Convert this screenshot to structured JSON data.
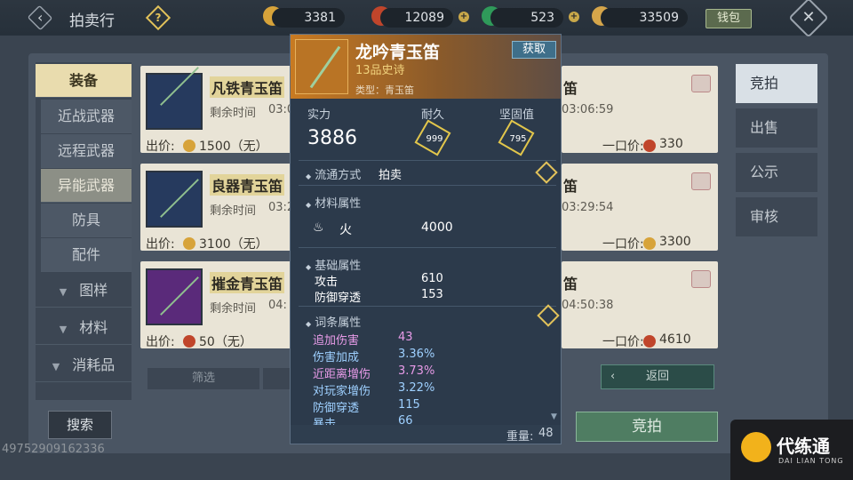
{
  "header": {
    "title": "拍卖行",
    "help": "?",
    "currencies": [
      {
        "icon": "gold-ingot-icon",
        "value": "3381",
        "color": "#d7a33a"
      },
      {
        "icon": "red-coin-icon",
        "value": "12089",
        "color": "#c0452b"
      },
      {
        "icon": "jade-icon",
        "value": "523",
        "color": "#2f9a5a"
      },
      {
        "icon": "feather-coin-icon",
        "value": "33509",
        "color": "#d5a54a"
      }
    ],
    "bag_label": "钱包"
  },
  "left_nav": [
    {
      "label": "装备",
      "state": "active"
    },
    {
      "label": "近战武器"
    },
    {
      "label": "远程武器"
    },
    {
      "label": "异能武器",
      "state": "sub"
    },
    {
      "label": "防具"
    },
    {
      "label": "配件"
    },
    {
      "label": "图样"
    },
    {
      "label": "材料"
    },
    {
      "label": "消耗品"
    }
  ],
  "listings": [
    {
      "name": "凡铁青玉笛",
      "remain_label": "剩余时间",
      "remain": "03:0",
      "price_label": "出价:",
      "price": "1500（无）",
      "thumb_color": "#263a5e"
    },
    {
      "name": "良器青玉笛",
      "remain_label": "剩余时间",
      "remain": "03:2",
      "price_label": "出价:",
      "price": "3100（无）",
      "thumb_color": "#263a5e"
    },
    {
      "name": "摧金青玉笛",
      "remain_label": "剩余时间",
      "remain": "04:",
      "price_label": "出价:",
      "price": "50（无）",
      "thumb_color": "#5a2a7a"
    }
  ],
  "listings_right": [
    {
      "name": "笛",
      "remain": "03:06:59",
      "buyout_label": "一口价:",
      "buyout": "330"
    },
    {
      "name": "笛",
      "remain": "03:29:54",
      "buyout_label": "一口价:",
      "buyout": "3300"
    },
    {
      "name": "笛",
      "remain": "04:50:38",
      "buyout_label": "一口价:",
      "buyout": "4610"
    }
  ],
  "right_nav": [
    "竞拍",
    "出售",
    "公示",
    "审核"
  ],
  "filter_label": "筛选",
  "return_label": "返回",
  "search_label": "搜索",
  "bid_label": "竞拍",
  "player_id": "49752909162336",
  "brand": {
    "name": "代练通",
    "sub": "DAI LIAN TONG"
  },
  "popup": {
    "name": "龙吟青玉笛",
    "rarity": "13品史诗",
    "type": "类型：青玉笛",
    "get_label": "获取",
    "stats": {
      "power_label": "实力",
      "power": "3886",
      "durability_label": "耐久",
      "durability": "999",
      "firmness_label": "坚固值",
      "firmness": "795"
    },
    "circulation": {
      "label": "流通方式",
      "value": "拍卖"
    },
    "material": {
      "label": "材料属性",
      "element": "火",
      "value": "4000"
    },
    "base": {
      "label": "基础属性",
      "rows": [
        {
          "k": "攻击",
          "v": "610"
        },
        {
          "k": "防御穿透",
          "v": "153"
        }
      ]
    },
    "affix": {
      "label": "词条属性",
      "rows": [
        {
          "k": "追加伤害",
          "v": "43",
          "c": "pink"
        },
        {
          "k": "伤害加成",
          "v": "3.36%",
          "c": "blue"
        },
        {
          "k": "近距离增伤",
          "v": "3.73%",
          "c": "pink"
        },
        {
          "k": "对玩家增伤",
          "v": "3.22%",
          "c": "blue"
        },
        {
          "k": "防御穿透",
          "v": "115",
          "c": "blue"
        },
        {
          "k": "暴击",
          "v": "66",
          "c": "blue"
        }
      ]
    },
    "weight_label": "重量:",
    "weight": "48"
  }
}
